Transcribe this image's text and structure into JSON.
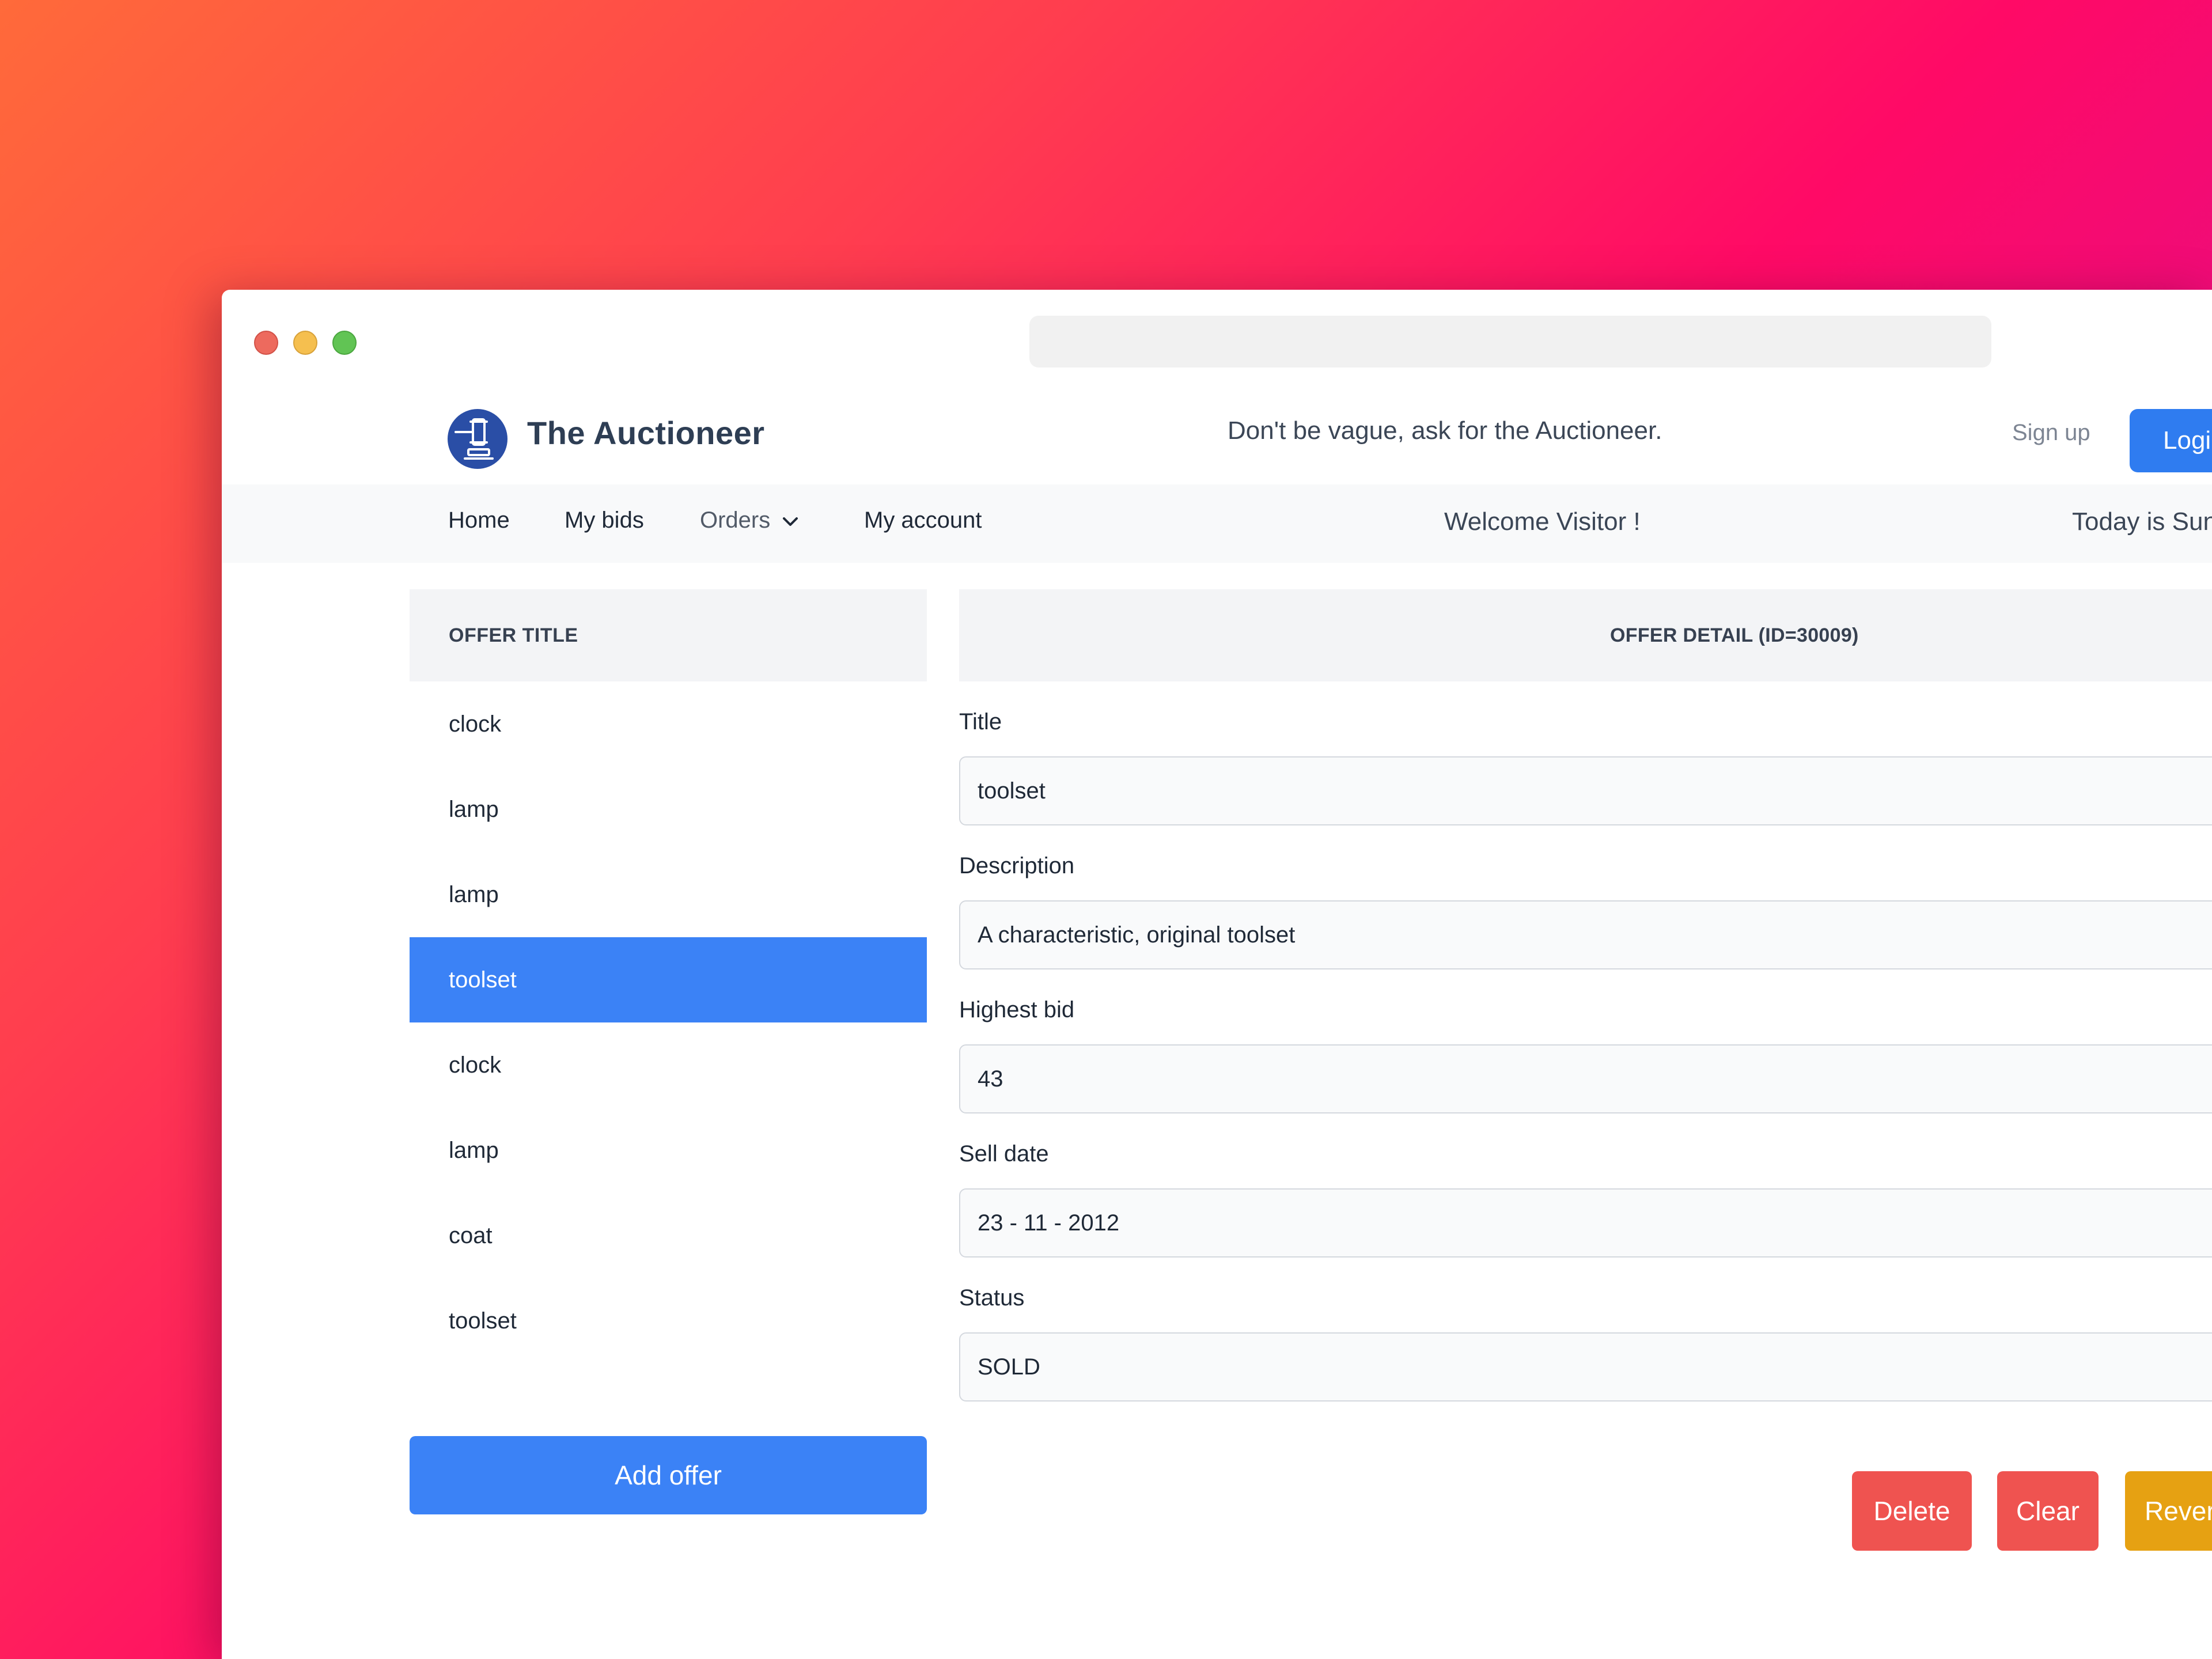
{
  "header": {
    "brand": "The Auctioneer",
    "tagline": "Don't be vague, ask for the Auctioneer.",
    "signup_label": "Sign up",
    "login_label": "Login"
  },
  "nav": {
    "home": "Home",
    "my_bids": "My bids",
    "orders": "Orders",
    "my_account": "My account",
    "welcome": "Welcome Visitor !",
    "today": "Today is Sunday"
  },
  "offers": {
    "header": "OFFER TITLE",
    "items": [
      "clock",
      "lamp",
      "lamp",
      "toolset",
      "clock",
      "lamp",
      "coat",
      "toolset"
    ],
    "selected_index": 3,
    "add_label": "Add offer"
  },
  "detail": {
    "header": "OFFER DETAIL (ID=30009)",
    "title_label": "Title",
    "title_value": "toolset",
    "description_label": "Description",
    "description_value": "A characteristic, original toolset",
    "highest_bid_label": "Highest bid",
    "highest_bid_value": "43",
    "sell_date_label": "Sell date",
    "sell_date_value": "23 - 11 - 2012",
    "status_label": "Status",
    "status_value": "SOLD"
  },
  "actions": {
    "delete_label": "Delete",
    "clear_label": "Clear",
    "reverse_label": "Reverse"
  },
  "colors": {
    "primary": "#3b82f6",
    "danger": "#ef5350",
    "warning": "#e6a112",
    "brand_text": "#2e3e54"
  }
}
